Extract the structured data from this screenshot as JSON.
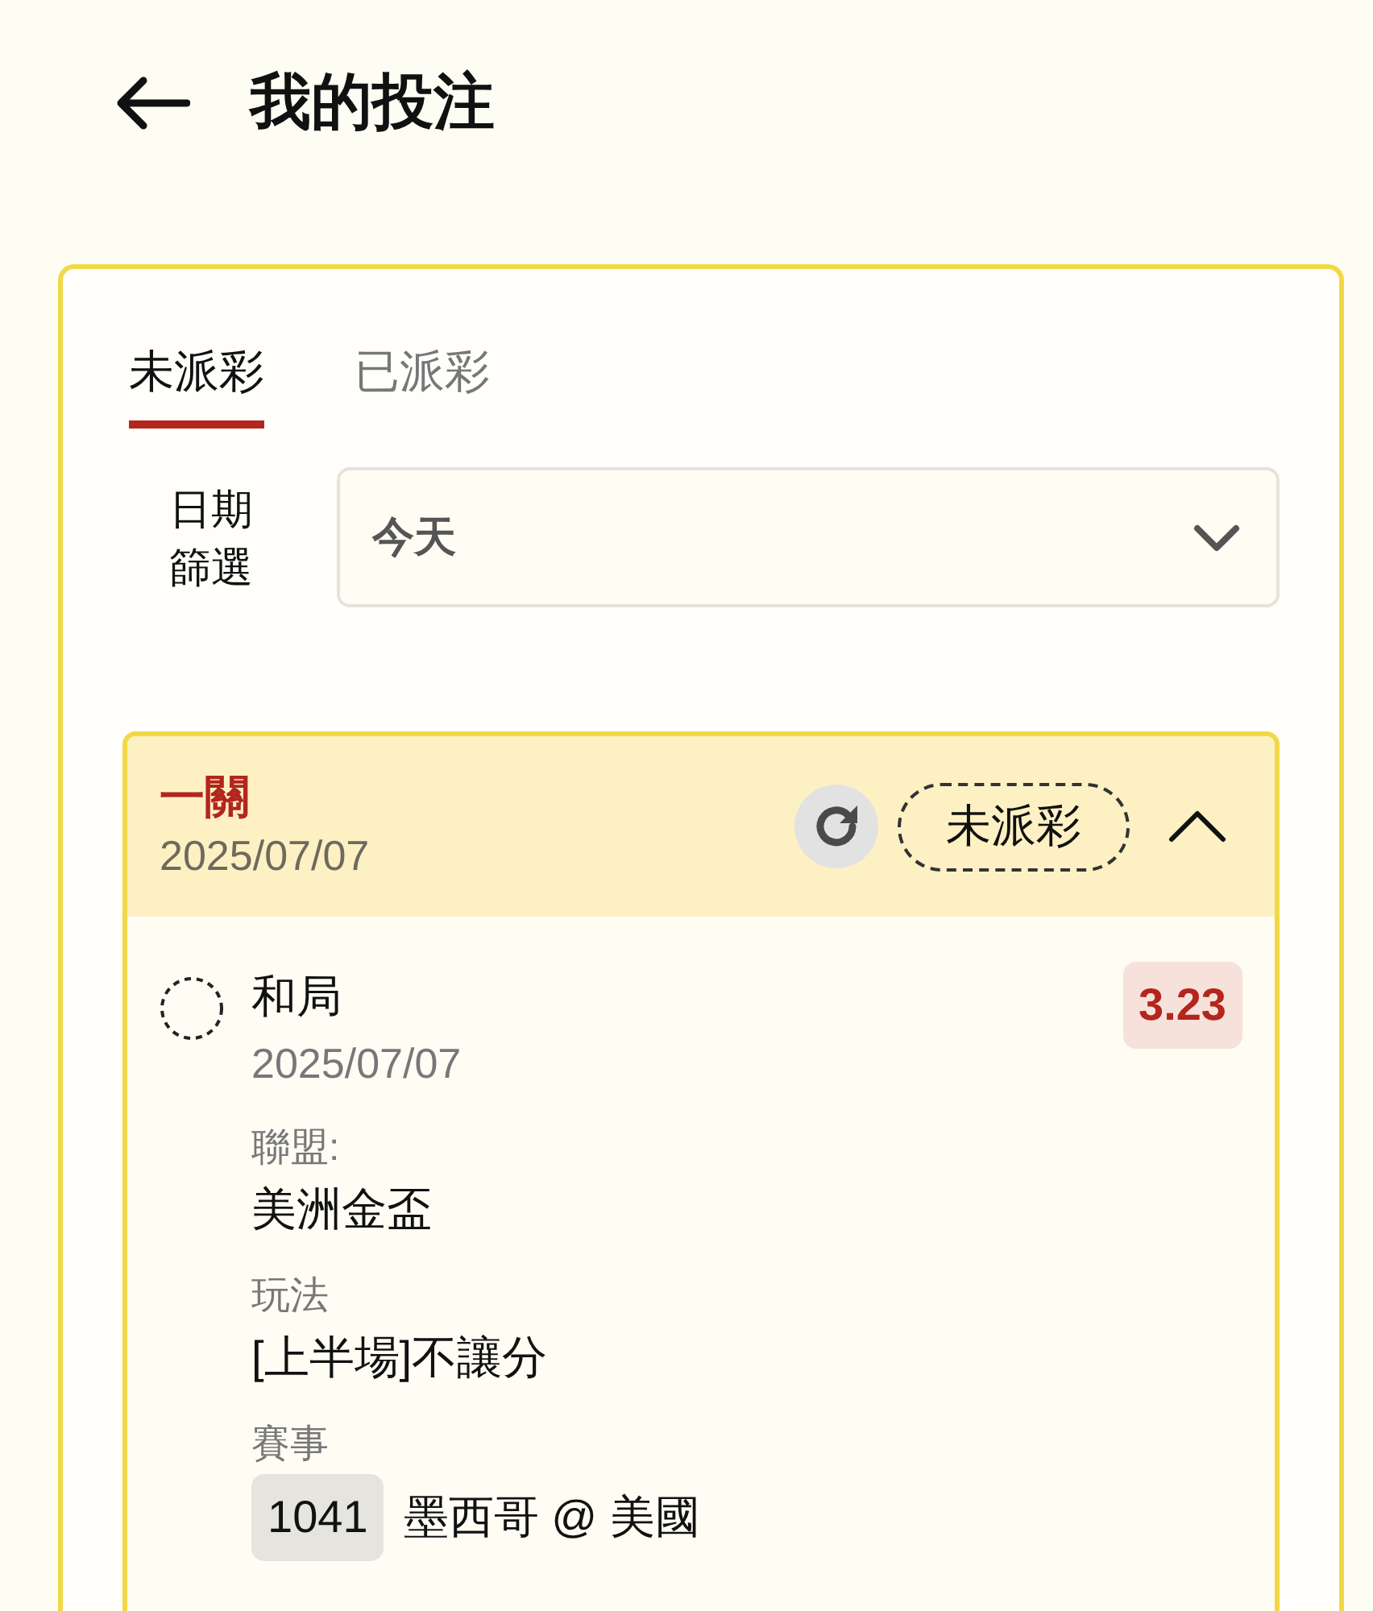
{
  "header": {
    "title": "我的投注"
  },
  "tabs": [
    {
      "label": "未派彩",
      "selected": true
    },
    {
      "label": "已派彩",
      "selected": false
    }
  ],
  "date_filter": {
    "label": "日期篩選",
    "value": "今天"
  },
  "bets": [
    {
      "type": "一關",
      "date": "2025/07/07",
      "status": "未派彩",
      "expanded": true,
      "selections": [
        {
          "pick": "和局",
          "date": "2025/07/07",
          "odds": "3.23",
          "fields": [
            {
              "label": "聯盟:",
              "value": "美洲金盃"
            },
            {
              "label": "玩法",
              "value": "[上半場]不讓分"
            },
            {
              "label": "賽事",
              "match_number": "1041",
              "value": "墨西哥 @ 美國"
            }
          ]
        }
      ]
    }
  ]
}
